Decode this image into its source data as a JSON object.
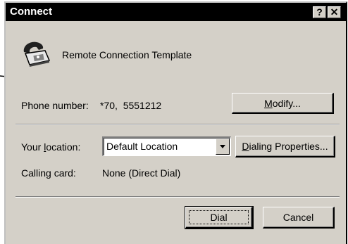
{
  "window": {
    "title": "Connect",
    "help_label": "?",
    "close_label": "✕"
  },
  "header": {
    "icon": "telephone-icon",
    "connection_name": "Remote Connection Template"
  },
  "phone": {
    "label": "Phone number:",
    "value": "*70,  5551212",
    "modify_label": "Modify..."
  },
  "location": {
    "label": "Your location:",
    "selected": "Default Location",
    "dialing_properties_label": "Dialing Properties..."
  },
  "calling_card": {
    "label": "Calling card:",
    "value": "None (Direct Dial)"
  },
  "actions": {
    "dial_label": "Dial",
    "cancel_label": "Cancel"
  }
}
